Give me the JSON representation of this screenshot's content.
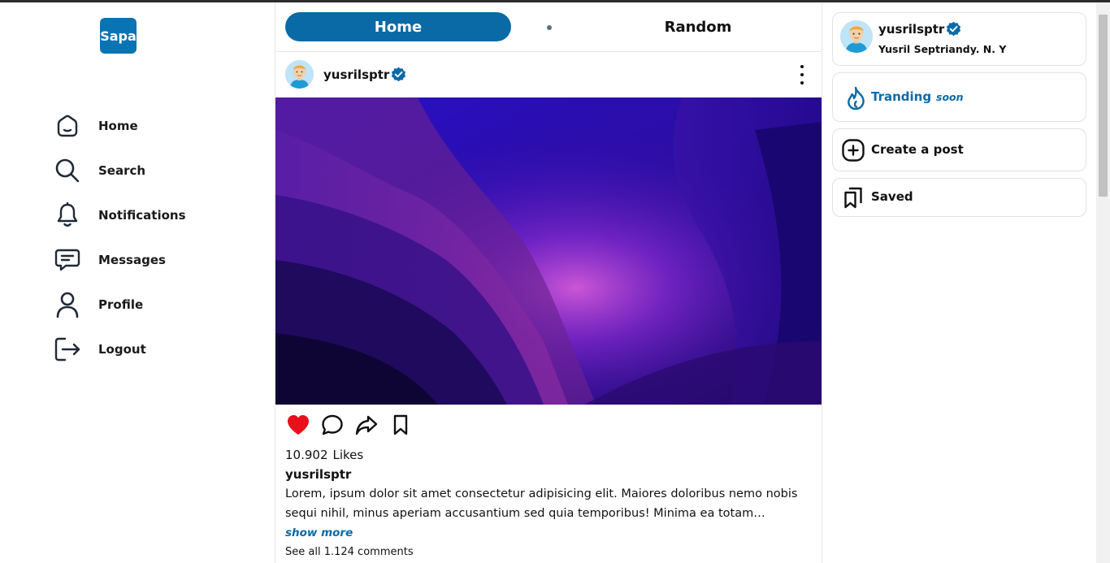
{
  "app": {
    "logo_text": "Sapa"
  },
  "sidebar": {
    "items": [
      {
        "label": "Home",
        "icon": "home-icon"
      },
      {
        "label": "Search",
        "icon": "search-icon"
      },
      {
        "label": "Notifications",
        "icon": "bell-icon"
      },
      {
        "label": "Messages",
        "icon": "message-icon"
      },
      {
        "label": "Profile",
        "icon": "user-icon"
      },
      {
        "label": "Logout",
        "icon": "logout-icon"
      }
    ]
  },
  "feed": {
    "tabs": {
      "home": "Home",
      "random": "Random",
      "active": "Home"
    },
    "post": {
      "username": "yusrilsptr",
      "verified": true,
      "likes_count": "10.902",
      "likes_label": "Likes",
      "caption_user": "yusrilsptr",
      "caption": "Lorem, ipsum dolor sit amet consectetur adipisicing elit. Maiores doloribus nemo nobis sequi nihil, minus aperiam accusantium sed quia temporibus! Minima ea totam temporibus nulla at commodi.",
      "show_more": "show more",
      "comments_text": "See all 1.124 comments",
      "liked": true
    }
  },
  "right_panel": {
    "profile": {
      "username": "yusrilsptr",
      "full_name": "Yusril Septriandy. N. Y",
      "verified": true
    },
    "trending": {
      "label": "Tranding",
      "badge": "soon"
    },
    "create_post": {
      "label": "Create a post"
    },
    "saved": {
      "label": "Saved"
    }
  },
  "colors": {
    "accent": "#0a6aa6",
    "like": "#e8101a",
    "background": "#ffffff"
  }
}
